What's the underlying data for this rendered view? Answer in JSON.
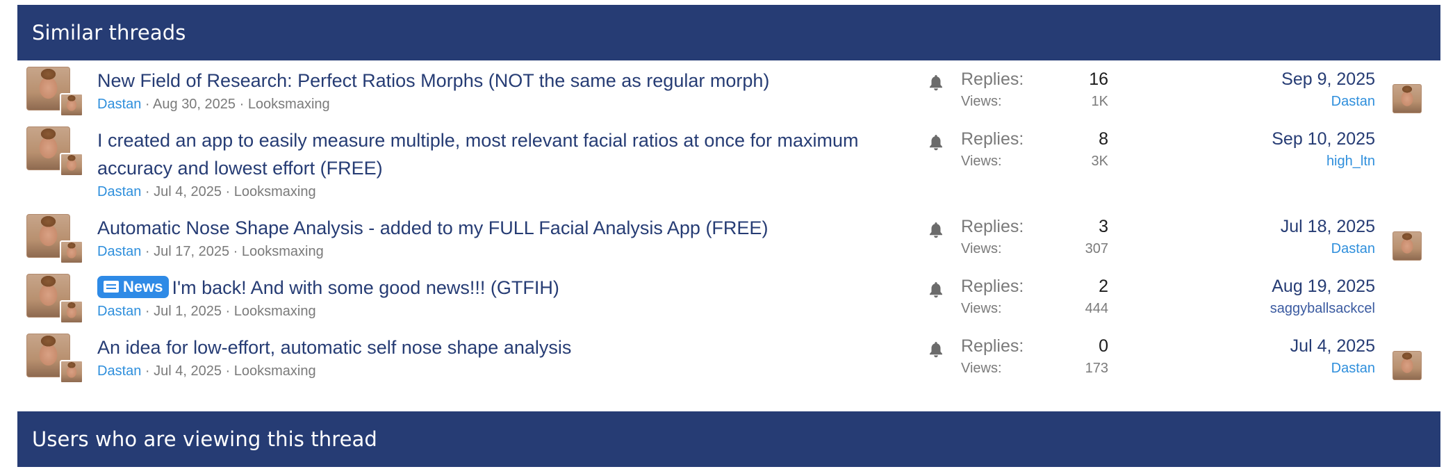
{
  "similar_threads": {
    "header": "Similar threads",
    "threads": [
      {
        "title": "New Field of Research: Perfect Ratios Morphs (NOT the same as regular morph)",
        "author": "Dastan",
        "meta_rest": " · Aug 30, 2025 · Looksmaxing",
        "replies_label": "Replies:",
        "replies": "16",
        "views_label": "Views:",
        "views": "1K",
        "last_date": "Sep 9, 2025",
        "last_user": "Dastan"
      },
      {
        "title": "I created an app to easily measure multiple, most relevant facial ratios at once for maximum accuracy and lowest effort (FREE)",
        "author": "Dastan",
        "meta_rest": " · Jul 4, 2025 · Looksmaxing",
        "replies_label": "Replies:",
        "replies": "8",
        "views_label": "Views:",
        "views": "3K",
        "last_date": "Sep 10, 2025",
        "last_user": "high_ltn"
      },
      {
        "title": "Automatic Nose Shape Analysis - added to my FULL Facial Analysis App (FREE)",
        "author": "Dastan",
        "meta_rest": " · Jul 17, 2025 · Looksmaxing",
        "replies_label": "Replies:",
        "replies": "3",
        "views_label": "Views:",
        "views": "307",
        "last_date": "Jul 18, 2025",
        "last_user": "Dastan"
      },
      {
        "prefix": "News",
        "title": "I'm back! And with some good news!!! (GTFIH)",
        "author": "Dastan",
        "meta_rest": " · Jul 1, 2025 · Looksmaxing",
        "replies_label": "Replies:",
        "replies": "2",
        "views_label": "Views:",
        "views": "444",
        "last_date": "Aug 19, 2025",
        "last_user": "saggyballsackcel"
      },
      {
        "title": "An idea for low-effort, automatic self nose shape analysis",
        "author": "Dastan",
        "meta_rest": " · Jul 4, 2025 · Looksmaxing",
        "replies_label": "Replies:",
        "replies": "0",
        "views_label": "Views:",
        "views": "173",
        "last_date": "Jul 4, 2025",
        "last_user": "Dastan"
      }
    ]
  },
  "viewers": {
    "header": "Users who are viewing this thread"
  },
  "icons": {
    "watch": "bell-icon",
    "prefix": "newspaper-icon"
  },
  "colors": {
    "header_bg": "#263c74",
    "title": "#263c74",
    "author_link": "#2f8fdc",
    "badge": "#2e8ae6"
  }
}
